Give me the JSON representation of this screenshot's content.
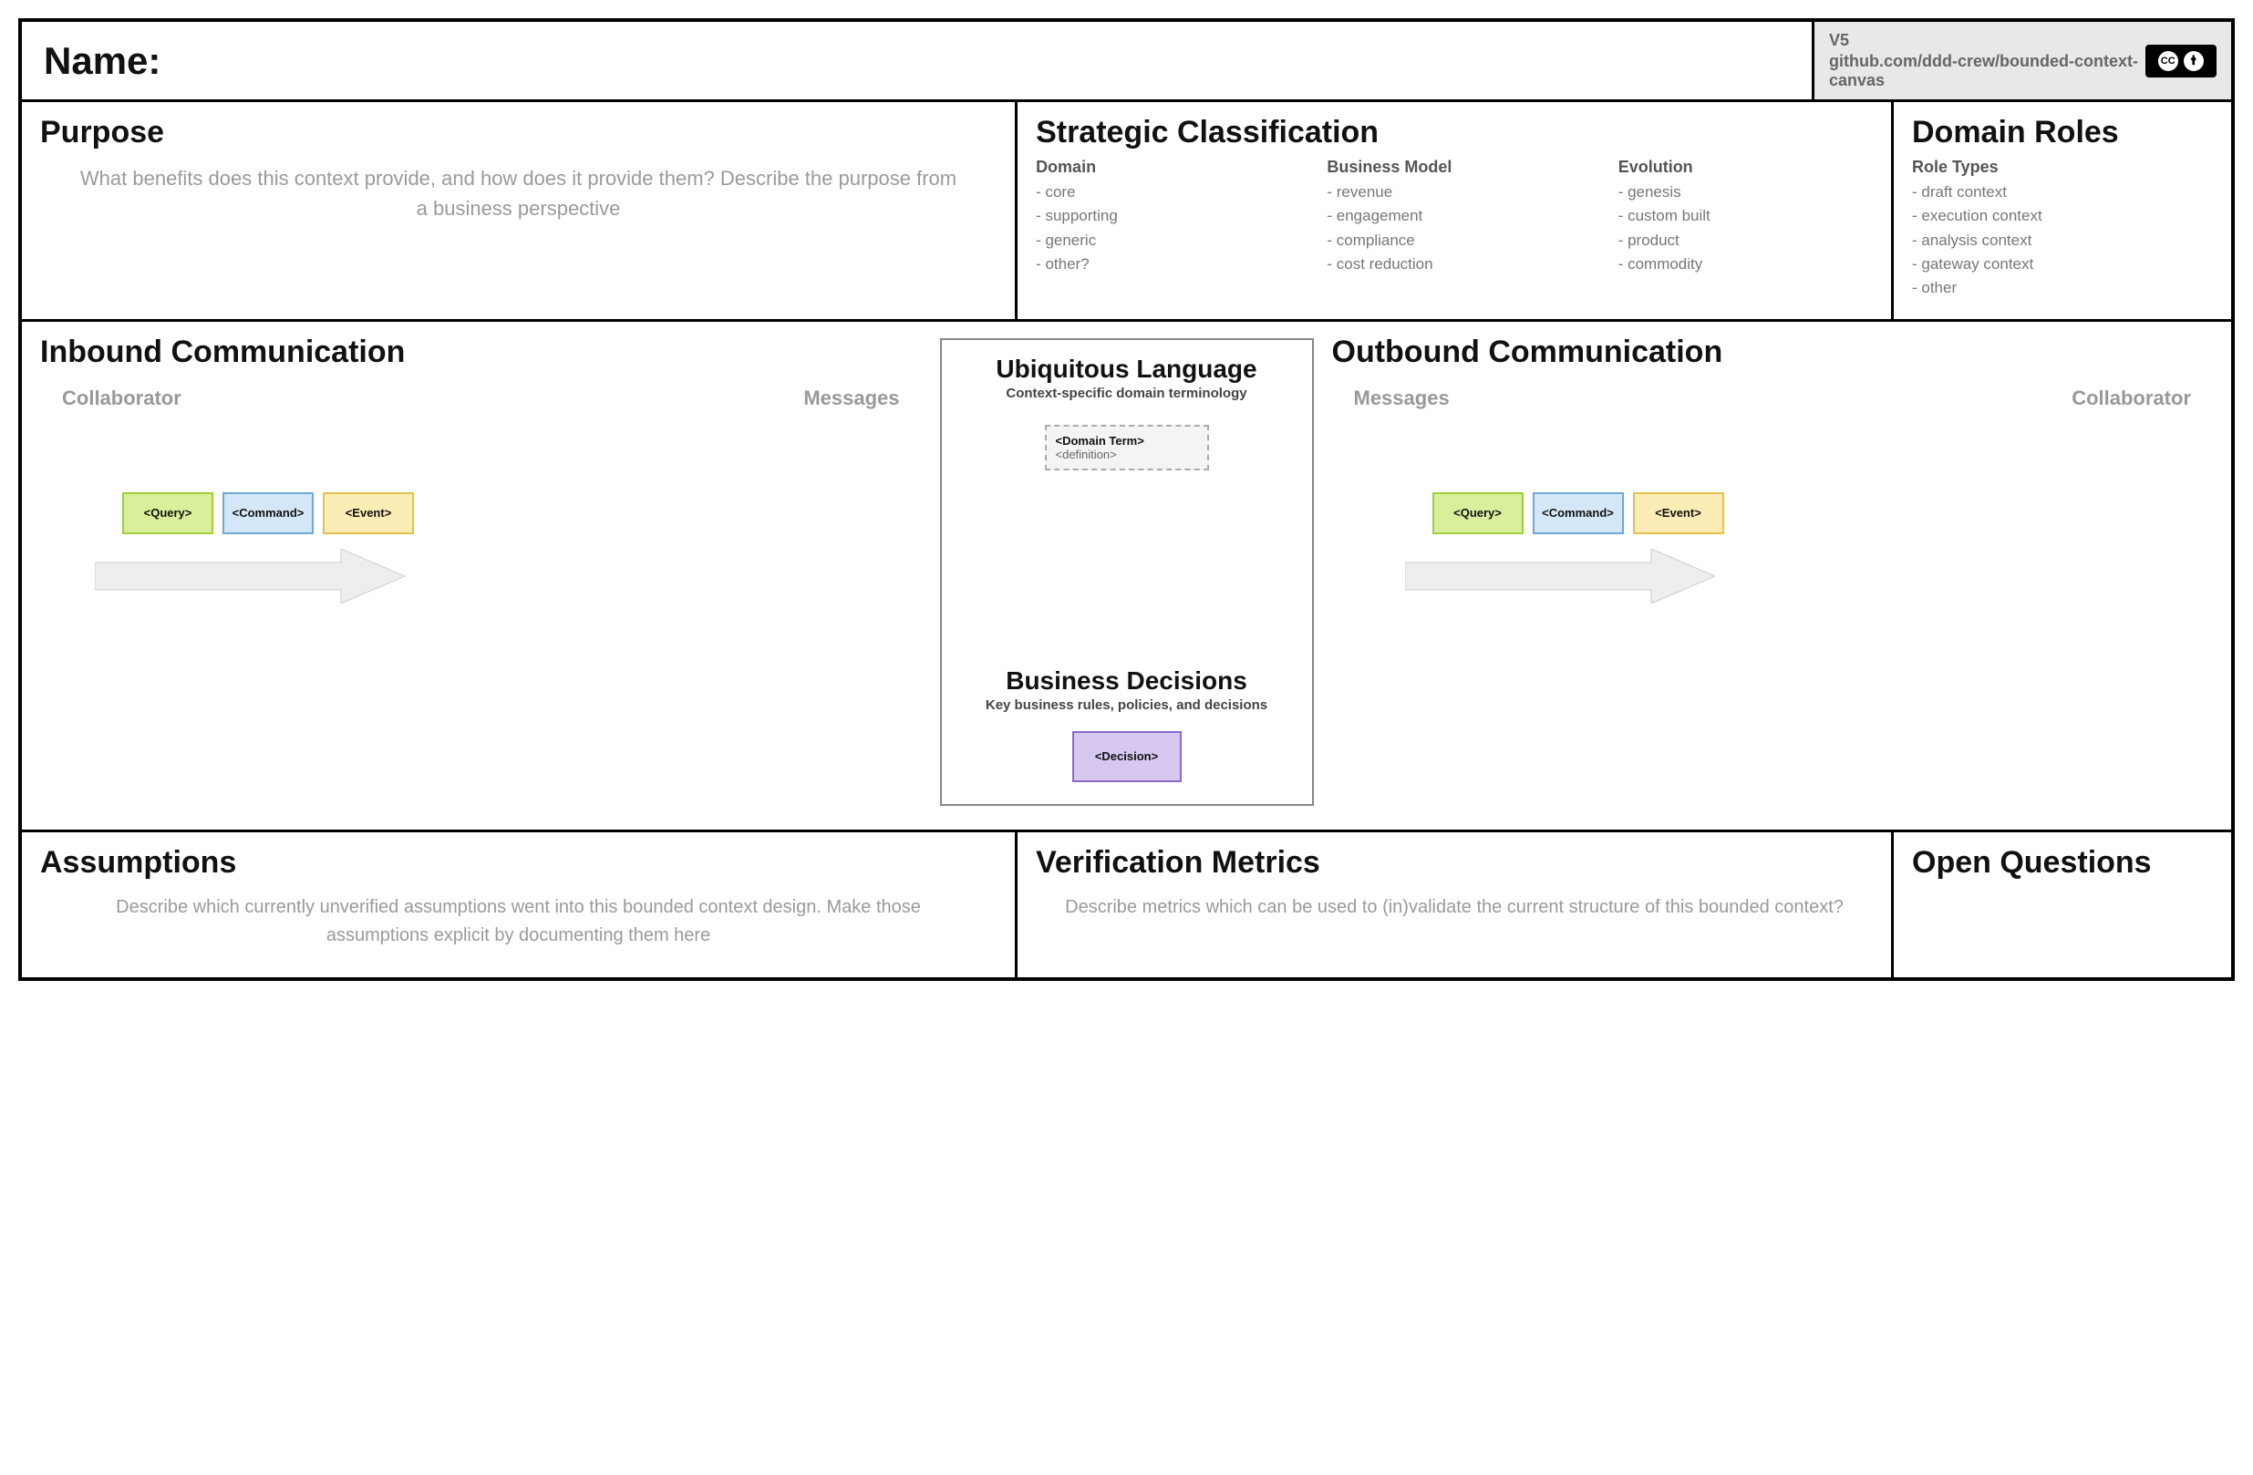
{
  "header": {
    "name_label": "Name:",
    "version": "V5",
    "repo": "github.com/ddd-crew/bounded-context-canvas",
    "license": "CC BY"
  },
  "purpose": {
    "title": "Purpose",
    "hint": "What benefits does this context provide, and how does it provide them? Describe the purpose from a business perspective"
  },
  "strategic": {
    "title": "Strategic Classification",
    "columns": [
      {
        "head": "Domain",
        "items": [
          "- core",
          "- supporting",
          "- generic",
          "- other?"
        ]
      },
      {
        "head": "Business Model",
        "items": [
          "- revenue",
          "- engagement",
          "- compliance",
          "- cost reduction"
        ]
      },
      {
        "head": "Evolution",
        "items": [
          "- genesis",
          "- custom built",
          "- product",
          "- commodity"
        ]
      }
    ]
  },
  "roles": {
    "title": "Domain Roles",
    "sub_head": "Role Types",
    "items": [
      "- draft context",
      "- execution context",
      "- analysis context",
      "- gateway context",
      "- other"
    ]
  },
  "inbound": {
    "title": "Inbound Communication",
    "collab": "Collaborator",
    "msgs": "Messages",
    "tags": {
      "query": "<Query>",
      "command": "<Command>",
      "event": "<Event>"
    }
  },
  "outbound": {
    "title": "Outbound Communication",
    "collab": "Collaborator",
    "msgs": "Messages",
    "tags": {
      "query": "<Query>",
      "command": "<Command>",
      "event": "<Event>"
    }
  },
  "center": {
    "ubiq_title": "Ubiquitous Language",
    "ubiq_sub": "Context-specific domain terminology",
    "term_name": "<Domain Term>",
    "term_def": "<definition>",
    "bdec_title": "Business Decisions",
    "bdec_sub": "Key business rules, policies, and decisions",
    "decision": "<Decision>"
  },
  "assumptions": {
    "title": "Assumptions",
    "hint": "Describe which currently unverified assumptions went into this bounded context design. Make those assumptions explicit by documenting them here"
  },
  "verification": {
    "title": "Verification Metrics",
    "hint": "Describe metrics which can be used to (in)validate the current structure of this bounded context?"
  },
  "openq": {
    "title": "Open Questions"
  }
}
